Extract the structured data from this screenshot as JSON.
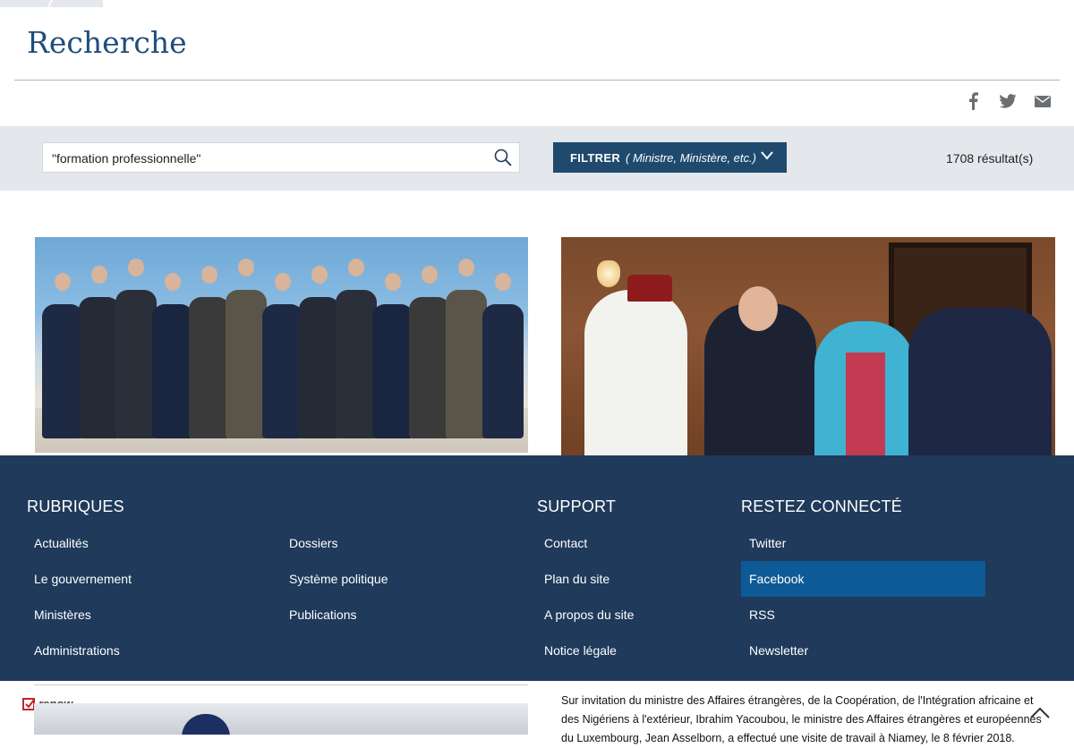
{
  "page": {
    "title": "Recherche"
  },
  "share": {
    "icons": [
      "facebook-icon",
      "twitter-icon",
      "mail-icon"
    ]
  },
  "search": {
    "value": "\"formation professionnelle\"",
    "icon": "search-icon"
  },
  "filter": {
    "label": "FILTRER",
    "hint": "( Ministre, Ministère,  etc.)",
    "icon": "chevron-down-icon"
  },
  "results": {
    "count_text": "1708 résultat(s)"
  },
  "footer": {
    "rubriques": {
      "heading": "RUBRIQUES",
      "col1": [
        "Actualités",
        "Le gouvernement",
        "Ministères",
        "Administrations"
      ],
      "col2": [
        "Dossiers",
        "Système politique",
        "Publications"
      ]
    },
    "support": {
      "heading": "SUPPORT",
      "links": [
        "Contact",
        "Plan du site",
        "A propos du site",
        "Notice légale"
      ]
    },
    "connect": {
      "heading": "RESTEZ CONNECTÉ",
      "links": [
        "Twitter",
        "Facebook",
        "RSS",
        "Newsletter"
      ],
      "active": "Facebook"
    }
  },
  "badge": {
    "label": "renow"
  },
  "article": {
    "text": "Sur invitation du ministre des Affaires étrangères, de la Coopération, de l'Intégration africaine et des Nigériens à l'extérieur, Ibrahim Yacoubou, le ministre des Affaires étrangères et européennes du Luxembourg, Jean Asselborn, a effectué une visite de travail à Niamey, le 8 février 2018."
  },
  "colors": {
    "title": "#1f4d7d",
    "search_band": "#e4e7eb",
    "filter_button": "#1f4a6e",
    "footer_bg": "#1f3a5a",
    "footer_active": "#0d5a96"
  }
}
